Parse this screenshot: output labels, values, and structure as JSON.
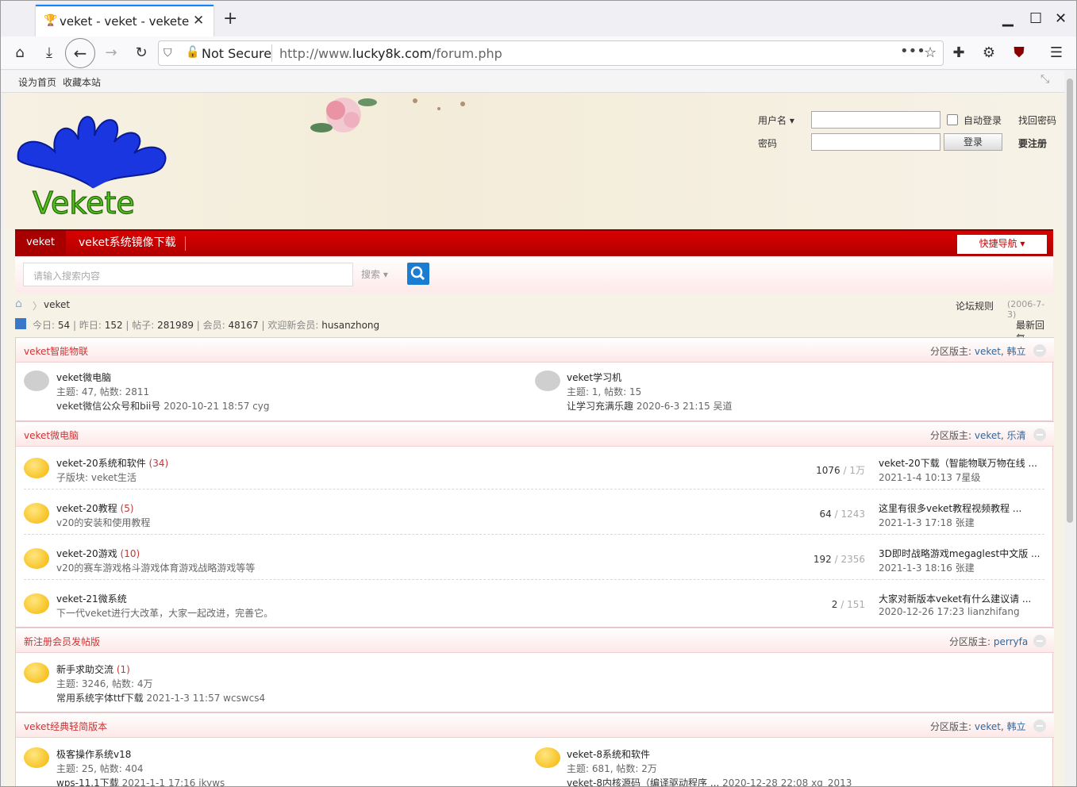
{
  "browser": {
    "tab_title": "veket - veket - vekete",
    "security": "Not Secure",
    "url_prefix": "http://www.",
    "url_domain": "lucky8k.com",
    "url_path": "/forum.php"
  },
  "bookmarks": {
    "set_home": "设为首页",
    "favorite": "收藏本站"
  },
  "header": {
    "logo_text": "Vekete",
    "username_label": "用户名",
    "password_label": "密码",
    "auto_login": "自动登录",
    "forgot_password": "找回密码",
    "login_button": "登录",
    "register": "要注册"
  },
  "menu": {
    "item1": "veket",
    "item2": "veket系统镜像下载",
    "quick_nav": "快捷导航"
  },
  "search": {
    "placeholder": "请输入搜索内容",
    "type": "搜索"
  },
  "breadcrumb": {
    "home": "veket",
    "rules": "论坛规则",
    "date": "(2006-7-3)"
  },
  "stats": {
    "today_label": "今日:",
    "today": "54",
    "yesterday_label": "昨日:",
    "yesterday": "152",
    "posts_label": "帖子:",
    "posts": "281989",
    "members_label": "会员:",
    "members": "48167",
    "newest_label": "欢迎新会员:",
    "newest": "husanzhong",
    "latest_reply": "最新回复"
  },
  "sections": [
    {
      "title": "veket智能物联",
      "mod_label": "分区版主:",
      "mods": [
        "veket",
        "韩立"
      ],
      "forums": [
        {
          "name": "veket微电脑",
          "stats": "主题: 47, 帖数: 2811",
          "last_title": "veket微信公众号和bii号",
          "last_time": "2020-10-21 18:57",
          "last_user": "cyg"
        },
        {
          "name": "veket学习机",
          "stats": "主题: 1, 帖数: 15",
          "last_title": "让学习充满乐趣",
          "last_time": "2020-6-3 21:15",
          "last_user": "吴道"
        }
      ]
    },
    {
      "title": "veket微电脑",
      "mod_label": "分区版主:",
      "mods": [
        "veket",
        "乐清"
      ],
      "forums": [
        {
          "name": "veket-20系统和软件",
          "count": "(34)",
          "desc": "子版块: veket生活",
          "threads": "1076",
          "posts": "1万",
          "last_title": "veket-20下载（智能物联万物在线 ...",
          "last_time": "2021-1-4 10:13",
          "last_user": "7星级"
        },
        {
          "name": "veket-20教程",
          "count": "(5)",
          "desc": "v20的安装和使用教程",
          "threads": "64",
          "posts": "1243",
          "last_title": "这里有很多veket教程视频教程 ...",
          "last_time": "2021-1-3 17:18",
          "last_user": "张建"
        },
        {
          "name": "veket-20游戏",
          "count": "(10)",
          "desc": "v20的赛车游戏格斗游戏体育游戏战略游戏等等",
          "threads": "192",
          "posts": "2356",
          "last_title": "3D即时战略游戏megaglest中文版 ...",
          "last_time": "2021-1-3 18:16",
          "last_user": "张建"
        },
        {
          "name": "veket-21微系统",
          "count": "",
          "desc": "下一代veket进行大改革，大家一起改进，完善它。",
          "threads": "2",
          "posts": "151",
          "last_title": "大家对新版本veket有什么建议请 ...",
          "last_time": "2020-12-26 17:23",
          "last_user": "lianzhifang"
        }
      ]
    },
    {
      "title": "新注册会员发帖版",
      "mod_label": "分区版主:",
      "mods": [
        "perryfa"
      ],
      "forums": [
        {
          "name": "新手求助交流",
          "count": "(1)",
          "stats": "主题: 3246, 帖数: 4万",
          "last_title": "常用系统字体ttf下载",
          "last_time": "2021-1-3 11:57",
          "last_user": "wcswcs4"
        }
      ]
    },
    {
      "title": "veket经典轻简版本",
      "mod_label": "分区版主:",
      "mods": [
        "veket",
        "韩立"
      ],
      "forums": [
        {
          "name": "极客操作系统v18",
          "stats": "主题: 25, 帖数: 404",
          "last_title": "wps-11.1下载",
          "last_time": "2021-1-1 17:16",
          "last_user": "ikyws"
        },
        {
          "name": "veket-8系统和软件",
          "stats": "主题: 681, 帖数: 2万",
          "last_title": "veket-8内核源码（编译驱动程序 ...",
          "last_time": "2020-12-28 22:08",
          "last_user": "xq_2013"
        }
      ]
    }
  ]
}
